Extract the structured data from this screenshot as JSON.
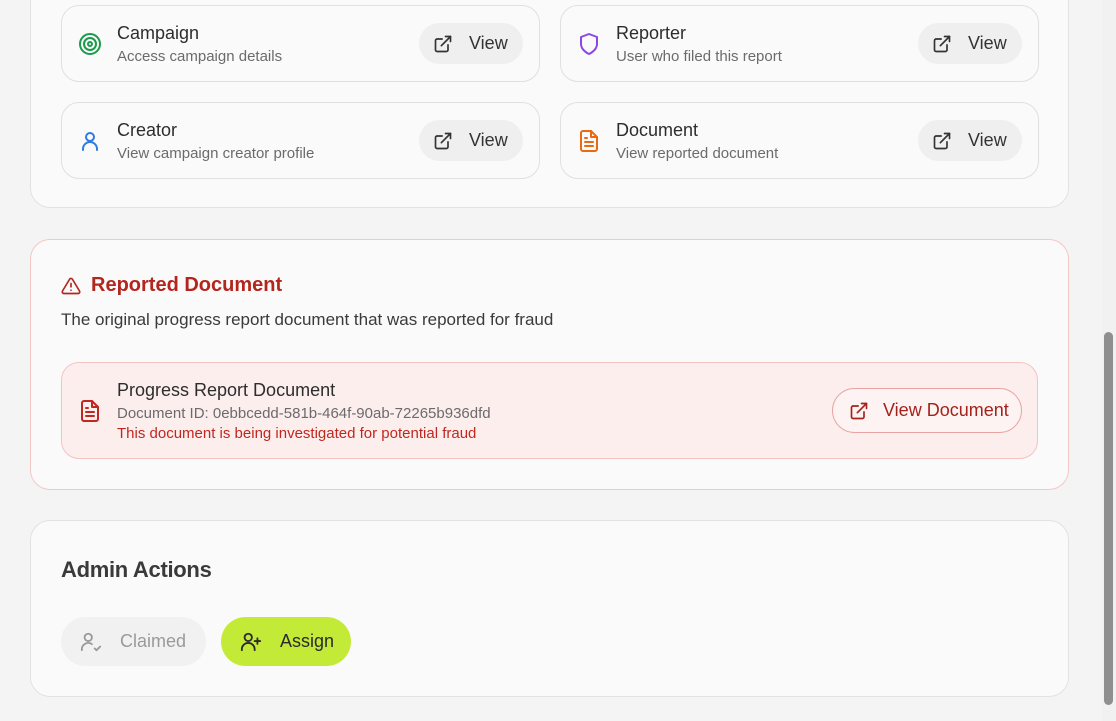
{
  "links": {
    "campaign": {
      "title": "Campaign",
      "subtitle": "Access campaign details",
      "button": "View",
      "icon": "target-icon"
    },
    "reporter": {
      "title": "Reporter",
      "subtitle": "User who filed this report",
      "button": "View",
      "icon": "shield-icon"
    },
    "creator": {
      "title": "Creator",
      "subtitle": "View campaign creator profile",
      "button": "View",
      "icon": "user-icon"
    },
    "document": {
      "title": "Document",
      "subtitle": "View reported document",
      "button": "View",
      "icon": "file-text-icon"
    }
  },
  "reported": {
    "title": "Reported Document",
    "description": "The original progress report document that was reported for fraud",
    "doc_name": "Progress Report Document",
    "doc_id": "Document ID: 0ebbcedd-581b-464f-90ab-72265b936dfd",
    "warning": "This document is being investigated for potential fraud",
    "button": "View Document"
  },
  "admin": {
    "title": "Admin Actions",
    "claimed_label": "Claimed",
    "assign_label": "Assign"
  },
  "colors": {
    "accent": "#c4ea38",
    "danger": "#b3261e",
    "campaign_icon": "#1a9b4b",
    "reporter_icon": "#8b47e6",
    "creator_icon": "#2f7be0",
    "document_icon": "#ea6a12"
  }
}
